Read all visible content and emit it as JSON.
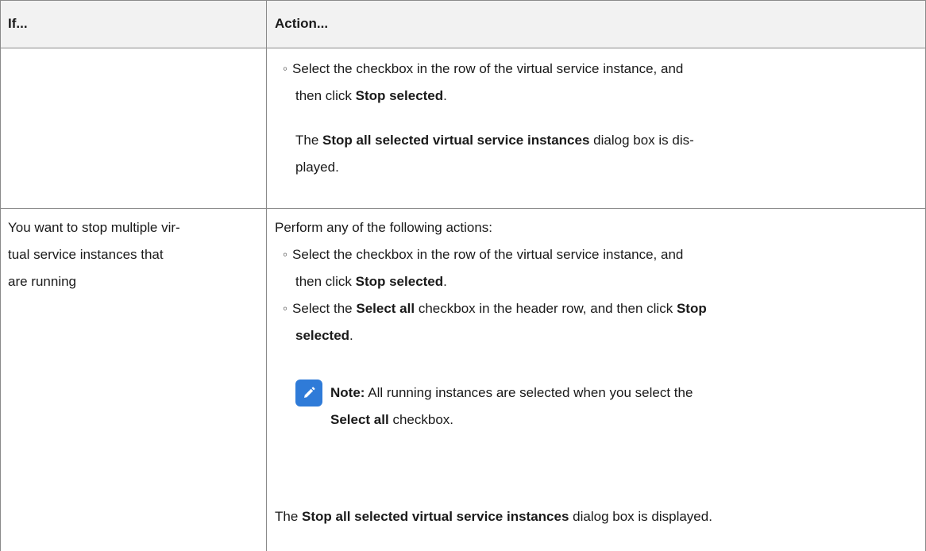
{
  "table": {
    "headers": {
      "if": "If...",
      "action": "Action..."
    },
    "row1": {
      "bullet1_text": "Select the checkbox in the row of the virtual service instance, and",
      "bullet1_cont": "then click",
      "bullet1_bold": "Stop selected",
      "bullet1_end": ".",
      "result_pre": "The",
      "result_bold": "Stop all selected virtual service instances",
      "result_post": "dialog box is dis-",
      "result_cont": "played."
    },
    "row2": {
      "condition_lines": [
        "You want to stop multiple vir-",
        "tual service instances that",
        "are running"
      ],
      "intro": "Perform any of the following actions:",
      "bullet1_text": "Select the checkbox in the row of the virtual service instance, and",
      "bullet1_cont": "then click",
      "bullet1_bold": "Stop selected",
      "bullet1_end": ".",
      "bullet2_pre": "Select the",
      "bullet2_bold1": "Select all",
      "bullet2_mid": "checkbox in the header row, and then click",
      "bullet2_bold2": "Stop",
      "bullet2_bold3": "selected",
      "bullet2_end": ".",
      "note_label": "Note:",
      "note_text": "All running instances are selected when you select the",
      "note_bold": "Select all",
      "note_end": "checkbox.",
      "result_pre": "The",
      "result_bold": "Stop all selected virtual service instances",
      "result_post": "dialog box is displayed."
    }
  },
  "colors": {
    "header_bg": "#f2f2f2",
    "border": "#8a8a8a",
    "note_icon": "#2f7bd8"
  },
  "icons": {
    "bullet": "◦",
    "note": "pencil-icon"
  }
}
